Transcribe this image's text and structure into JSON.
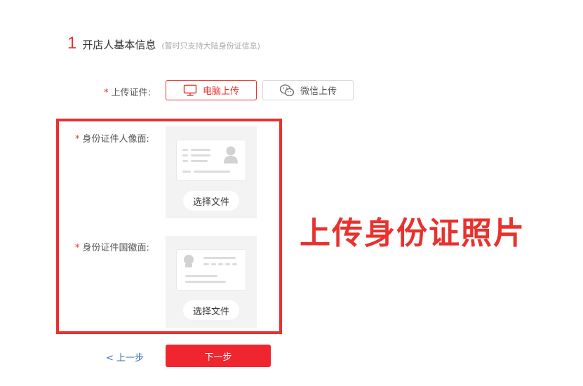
{
  "section": {
    "step_number": "1",
    "title": "开店人基本信息",
    "note": "(暂时只支持大陆身份证信息)"
  },
  "upload_method": {
    "required_mark": "*",
    "label": "上传证件:",
    "pc_label": "电脑上传",
    "wechat_label": "微信上传",
    "selected": "电脑上传"
  },
  "id_front": {
    "required_mark": "*",
    "label": "身份证件人像面:",
    "choose_label": "选择文件"
  },
  "id_back": {
    "required_mark": "*",
    "label": "身份证件国徽面:",
    "choose_label": "选择文件"
  },
  "annotation": {
    "caption": "上传身份证照片"
  },
  "footer": {
    "prev_label": "< 上一步",
    "next_label": "下一步"
  },
  "colors": {
    "accent": "#e8322e",
    "primary_button": "#f0262e",
    "link": "#3a6fb3",
    "panel_bg": "#f3f3f3"
  },
  "icons": {
    "pc": "monitor-icon",
    "wechat": "wechat-icon",
    "id_front_placeholder": "id-card-front-icon",
    "id_back_placeholder": "id-card-back-icon"
  }
}
